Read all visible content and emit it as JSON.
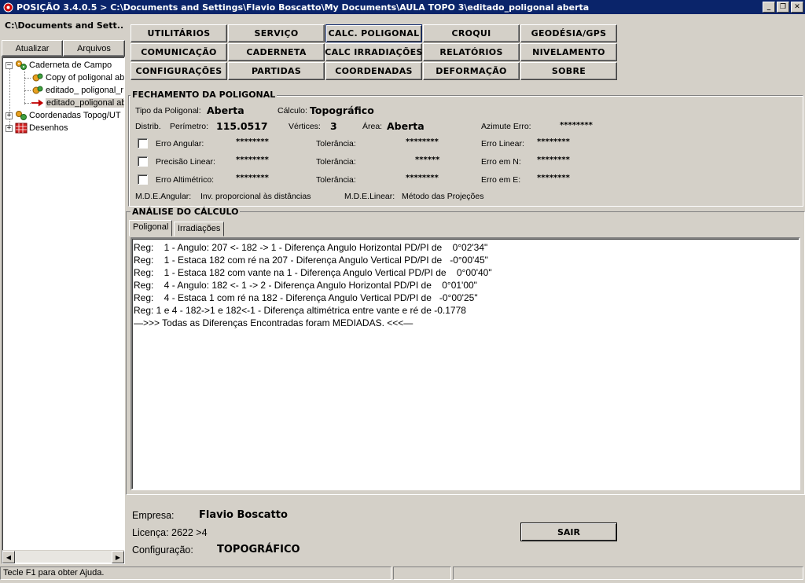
{
  "window": {
    "title": "POSIÇÃO 3.4.0.5 > C:\\Documents and Settings\\Flavio Boscatto\\My Documents\\AULA TOPO 3\\editado_poligonal aberta",
    "controls": {
      "minimize": "_",
      "restore": "❐",
      "close": "✕"
    }
  },
  "left": {
    "path": "C:\\Documents and Sett...",
    "buttons": {
      "atualizar": "Atualizar",
      "arquivos": "Arquivos"
    },
    "tree": [
      {
        "label": "Caderneta de Campo",
        "expander": "−",
        "icon": "gears-icon"
      },
      {
        "label": "Copy of poligonal ab",
        "icon": "gear-file-icon"
      },
      {
        "label": "editado_ poligonal_r",
        "icon": "gear-file-icon"
      },
      {
        "label": "editado_poligonal ab",
        "icon": "red-arrow-icon"
      },
      {
        "label": "Coordenadas Topog/UT",
        "expander": "+",
        "icon": "gears-icon"
      },
      {
        "label": "Desenhos",
        "expander": "+",
        "icon": "drawing-icon"
      }
    ]
  },
  "menu": [
    "UTILITÁRIOS",
    "SERVIÇO",
    "CALC. POLIGONAL",
    "CROQUI",
    "GEODÉSIA/GPS",
    "COMUNICAÇÃO",
    "CADERNETA",
    "CALC IRRADIAÇÕES",
    "RELATÓRIOS",
    "NIVELAMENTO",
    "CONFIGURAÇÕES",
    "PARTIDAS",
    "COORDENADAS",
    "DEFORMAÇÃO",
    "SOBRE"
  ],
  "fechamento": {
    "title": "FECHAMENTO DA POLIGONAL",
    "tipo_label": "Tipo da Poligonal:",
    "tipo_value": "Aberta",
    "calculo_label": "Cálculo:",
    "calculo_value": "Topográfico",
    "distrib_label": "Distrib.",
    "perimetro_label": "Perímetro:",
    "perimetro_value": "115.0517",
    "vertices_label": "Vértices:",
    "vertices_value": "3",
    "area_label": "Área:",
    "area_value": "Aberta",
    "azimute_label": "Azimute Erro:",
    "azimute_value": "********",
    "erro_angular_label": "Erro Angular:",
    "erro_angular_value": "********",
    "tol1_label": "Tolerância:",
    "tol1_value": "********",
    "erro_linear_label": "Erro Linear:",
    "erro_linear_value": "********",
    "precisao_label": "Precisão Linear:",
    "precisao_value": "********",
    "tol2_label": "Tolerância:",
    "tol2_value": "******",
    "erro_n_label": "Erro em N:",
    "erro_n_value": "********",
    "erro_alt_label": "Erro Altimétrico:",
    "erro_alt_value": "********",
    "tol3_label": "Tolerância:",
    "tol3_value": "********",
    "erro_e_label": "Erro em E:",
    "erro_e_value": "********",
    "mde_angular_label": "M.D.E.Angular:",
    "mde_angular_value": "Inv. proporcional às distâncias",
    "mde_linear_label": "M.D.E.Linear:",
    "mde_linear_value": "Método das Projeções"
  },
  "analise": {
    "title": "ANÁLISE DO CÁLCULO",
    "tabs": [
      "Poligonal",
      "Irradiações"
    ],
    "lines": [
      "Reg:    1 - Angulo: 207 <- 182 -> 1 - Diferença Angulo Horizontal PD/PI de    0°02'34\"",
      "Reg:    1 - Estaca 182 com ré na 207 - Diferença Angulo Vertical PD/PI de   -0°00'45\"",
      "Reg:    1 - Estaca 182 com vante na 1 - Diferença Angulo Vertical PD/PI de    0°00'40\"",
      "Reg:    4 - Angulo: 182 <- 1 -> 2 - Diferença Angulo Horizontal PD/PI de    0°01'00\"",
      "Reg:    4 - Estaca 1 com ré na 182 - Diferença Angulo Vertical PD/PI de   -0°00'25\"",
      "Reg: 1 e 4 - 182->1 e 182<-1 - Diferença altimétrica entre vante e ré de -0.1778",
      "—>>> Todas as Diferenças Encontradas foram MEDIADAS. <<<—"
    ]
  },
  "footer": {
    "empresa_label": "Empresa:",
    "empresa_value": "Flavio Boscatto",
    "licenca": "Licença: 2622 >4",
    "config_label": "Configuração:",
    "config_value": "TOPOGRÁFICO",
    "sair": "SAIR"
  },
  "status": {
    "help": "Tecle F1 para obter Ajuda."
  }
}
